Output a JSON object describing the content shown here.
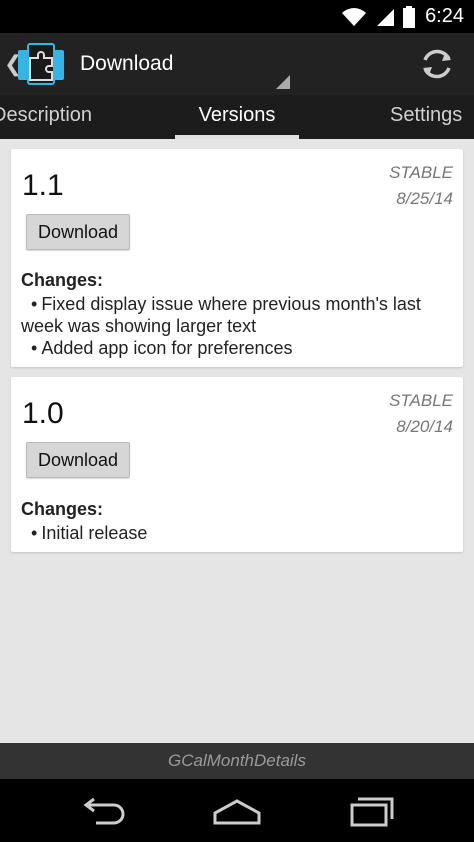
{
  "status_bar": {
    "time": "6:24",
    "icons": [
      "wifi-icon",
      "signal-icon",
      "battery-icon"
    ]
  },
  "action_bar": {
    "title": "Download",
    "icons": [
      "up-chevron-icon",
      "app-puzzle-icon",
      "refresh-icon"
    ],
    "up_glyph": "❮"
  },
  "tabs": [
    {
      "label": "Description",
      "active": false
    },
    {
      "label": "Versions",
      "active": true
    },
    {
      "label": "Settings",
      "active": false
    }
  ],
  "versions": [
    {
      "number": "1.1",
      "status": "STABLE",
      "date": "8/25/14",
      "download_label": "Download",
      "changes_heading": "Changes:",
      "changes": [
        "Fixed display issue where previous month's last week was showing larger text",
        "Added app icon for preferences"
      ]
    },
    {
      "number": "1.0",
      "status": "STABLE",
      "date": "8/20/14",
      "download_label": "Download",
      "changes_heading": "Changes:",
      "changes": [
        "Initial release"
      ]
    }
  ],
  "footer": {
    "module_name": "GCalMonthDetails"
  },
  "nav_bar": {
    "icons": [
      "back-icon",
      "home-icon",
      "recents-icon"
    ]
  },
  "colors": {
    "accent_teal": "#33b5e5",
    "action_bar": "#222222",
    "background": "#e5e5e5"
  }
}
